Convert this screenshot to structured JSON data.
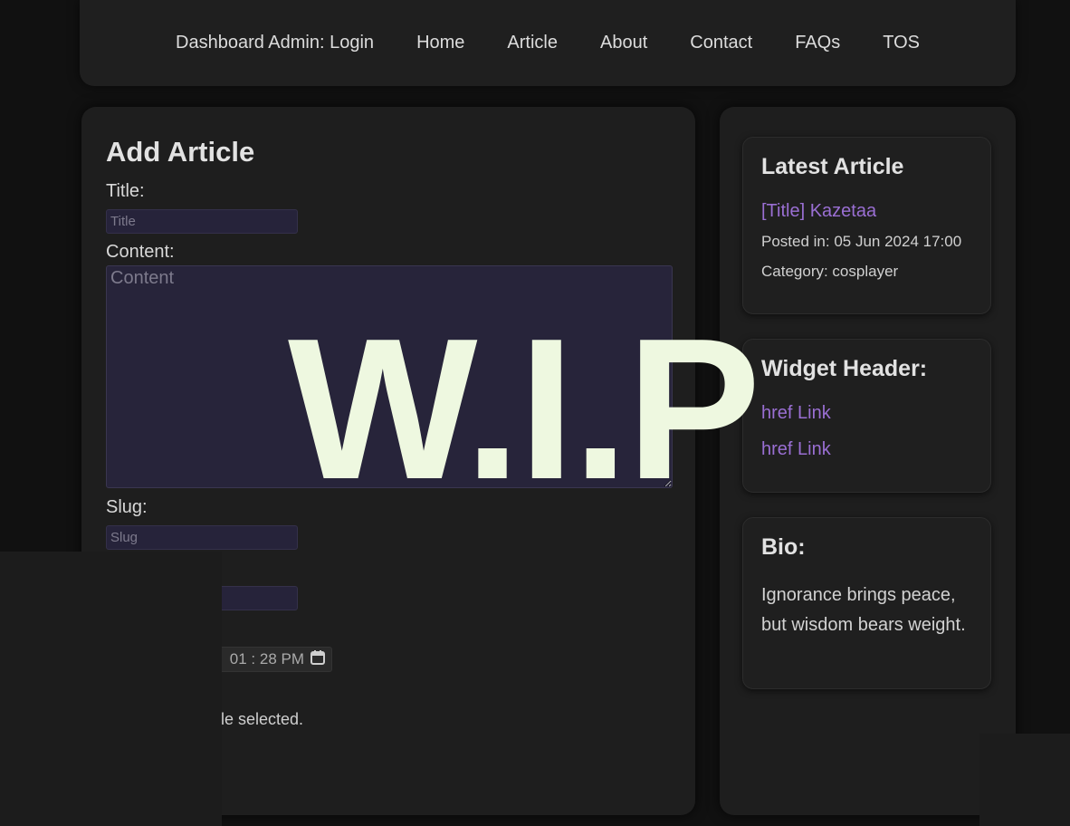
{
  "nav": {
    "items": [
      "Dashboard Admin: Login",
      "Home",
      "Article",
      "About",
      "Contact",
      "FAQs",
      "TOS"
    ]
  },
  "form": {
    "heading": "Add Article",
    "title_label": "Title:",
    "title_placeholder": "Title",
    "content_label": "Content:",
    "content_placeholder": "Content",
    "slug_label": "Slug:",
    "slug_placeholder": "Slug",
    "datetime_value": "01 : 28  PM",
    "file_status": "le selected."
  },
  "sidebar": {
    "latest": {
      "heading": "Latest Article",
      "link": "[Title] Kazetaa",
      "posted": "Posted in: 05 Jun 2024 17:00",
      "category": "Category: cosplayer"
    },
    "widget": {
      "heading": "Widget Header:",
      "links": [
        "href Link",
        "href Link"
      ]
    },
    "bio": {
      "heading": "Bio:",
      "text": "Ignorance brings peace, but wisdom bears weight."
    }
  },
  "overlay": {
    "text": "W.I.P"
  },
  "colors": {
    "background": "#111111",
    "panel": "#1e1e1e",
    "link": "#9a6fd3",
    "input_bg": "#26233a",
    "wip_text": "#eef8e0"
  },
  "icons": {
    "calendar": "calendar-icon"
  }
}
